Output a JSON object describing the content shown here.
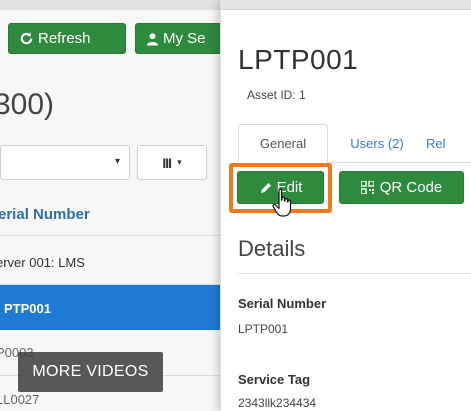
{
  "background": {
    "buttons": {
      "refresh": "Refresh",
      "my_search": "My Se"
    },
    "count_title": "300)",
    "select_caret": "▾",
    "columns_label": "III",
    "column_header": "erial Number",
    "rows": [
      {
        "text": "erver 001: LMS"
      },
      {
        "text": "PTP001"
      },
      {
        "text": "P0003"
      },
      {
        "text": "LL0027"
      }
    ],
    "more_videos": "MORE VIDEOS"
  },
  "panel": {
    "title": "LPTP001",
    "asset_id": "Asset ID: 1",
    "tabs": [
      {
        "label": "General"
      },
      {
        "label": "Users (2)"
      },
      {
        "label": "Rel"
      }
    ],
    "buttons": {
      "edit": "Edit",
      "qr_code": "QR Code"
    },
    "details_heading": "Details",
    "fields": [
      {
        "label": "Serial Number",
        "value": "LPTP001"
      },
      {
        "label": "Service Tag",
        "value": "2343llk234434"
      }
    ]
  },
  "colors": {
    "primary_green": "#2e8b3e",
    "highlight_orange": "#f07a1a",
    "selected_row": "#1f7ad6",
    "link_blue": "#3a7bc8"
  },
  "icons": {
    "refresh": "refresh-icon",
    "user": "user-icon",
    "pencil": "pencil-icon",
    "qr": "qr-code-icon",
    "cursor": "hand-pointer-icon"
  }
}
